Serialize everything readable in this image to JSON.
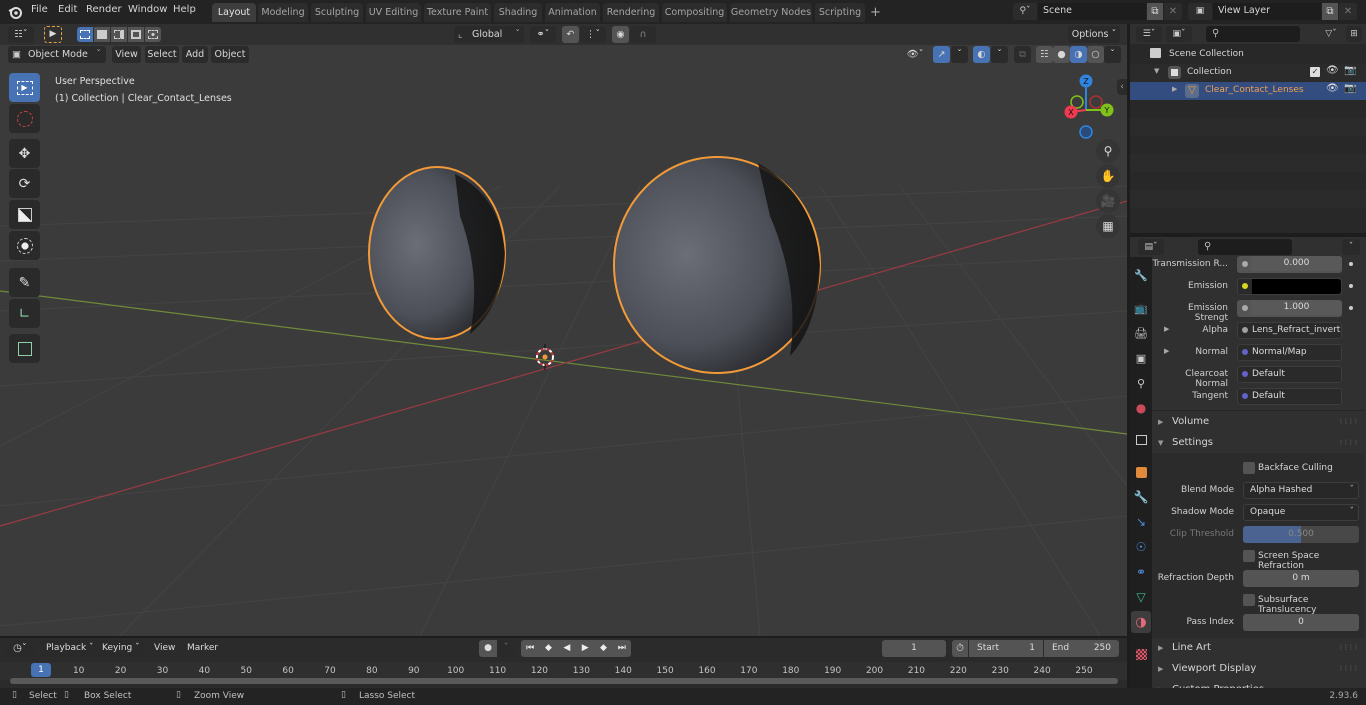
{
  "app": {
    "version": "2.93.6"
  },
  "menu": [
    "File",
    "Edit",
    "Render",
    "Window",
    "Help"
  ],
  "workspace_tabs": [
    "Layout",
    "Modeling",
    "Sculpting",
    "UV Editing",
    "Texture Paint",
    "Shading",
    "Animation",
    "Rendering",
    "Compositing",
    "Geometry Nodes",
    "Scripting"
  ],
  "workspace_active": "Layout",
  "scene": {
    "name": "Scene",
    "view_layer": "View Layer"
  },
  "viewport": {
    "mode": "Object Mode",
    "menus": [
      "View",
      "Select",
      "Add",
      "Object"
    ],
    "transform_orientation": "Global",
    "options_label": "Options",
    "overlay_title": "User Perspective",
    "overlay_subtitle": "(1) Collection | Clear_Contact_Lenses",
    "gizmo_axes": {
      "x": "X",
      "y": "Y",
      "z": "Z"
    },
    "colors": {
      "x_axis": "#f03a4f",
      "y_axis": "#80c21a",
      "z_axis": "#2f85e0",
      "selection": "#f29a38"
    }
  },
  "outliner": {
    "root": "Scene Collection",
    "items": [
      {
        "label": "Collection",
        "type": "collection"
      },
      {
        "label": "Clear_Contact_Lenses",
        "type": "mesh",
        "selected": true
      }
    ]
  },
  "properties": {
    "rows": [
      {
        "label": "Transmission R...",
        "value": "0.000",
        "kind": "number"
      },
      {
        "label": "Emission",
        "value": "",
        "kind": "color",
        "color": "#000000"
      },
      {
        "label": "Emission Strengt",
        "value": "1.000",
        "kind": "number"
      },
      {
        "label": "Alpha",
        "value": "Lens_Refract_invert...",
        "kind": "link"
      },
      {
        "label": "Normal",
        "value": "Normal/Map",
        "kind": "link"
      },
      {
        "label": "Clearcoat Normal",
        "value": "Default",
        "kind": "link"
      },
      {
        "label": "Tangent",
        "value": "Default",
        "kind": "link"
      }
    ],
    "sections": {
      "volume": "Volume",
      "settings": "Settings",
      "line_art": "Line Art",
      "viewport_display": "Viewport Display",
      "custom_properties": "Custom Properties"
    },
    "settings": {
      "backface_culling": {
        "label": "Backface Culling",
        "checked": false
      },
      "blend_mode": {
        "label": "Blend Mode",
        "value": "Alpha Hashed"
      },
      "shadow_mode": {
        "label": "Shadow Mode",
        "value": "Opaque"
      },
      "clip_threshold": {
        "label": "Clip Threshold",
        "value": "0.500",
        "fraction": 0.5
      },
      "screen_space_refraction": {
        "label": "Screen Space Refraction",
        "checked": false
      },
      "refraction_depth": {
        "label": "Refraction Depth",
        "value": "0 m"
      },
      "subsurface_translucency": {
        "label": "Subsurface Translucency",
        "checked": false
      },
      "pass_index": {
        "label": "Pass Index",
        "value": "0"
      }
    }
  },
  "timeline": {
    "menus": [
      "Playback",
      "Keying",
      "View",
      "Marker"
    ],
    "current_frame": "1",
    "start_label": "Start",
    "start": "1",
    "end_label": "End",
    "end": "250",
    "ticks": [
      "1",
      "10",
      "20",
      "30",
      "40",
      "50",
      "60",
      "70",
      "80",
      "90",
      "100",
      "110",
      "120",
      "130",
      "140",
      "150",
      "160",
      "170",
      "180",
      "190",
      "200",
      "210",
      "220",
      "230",
      "240",
      "250"
    ]
  },
  "statusbar": {
    "items": [
      "Select",
      "Box Select",
      "Zoom View",
      "Lasso Select"
    ]
  }
}
